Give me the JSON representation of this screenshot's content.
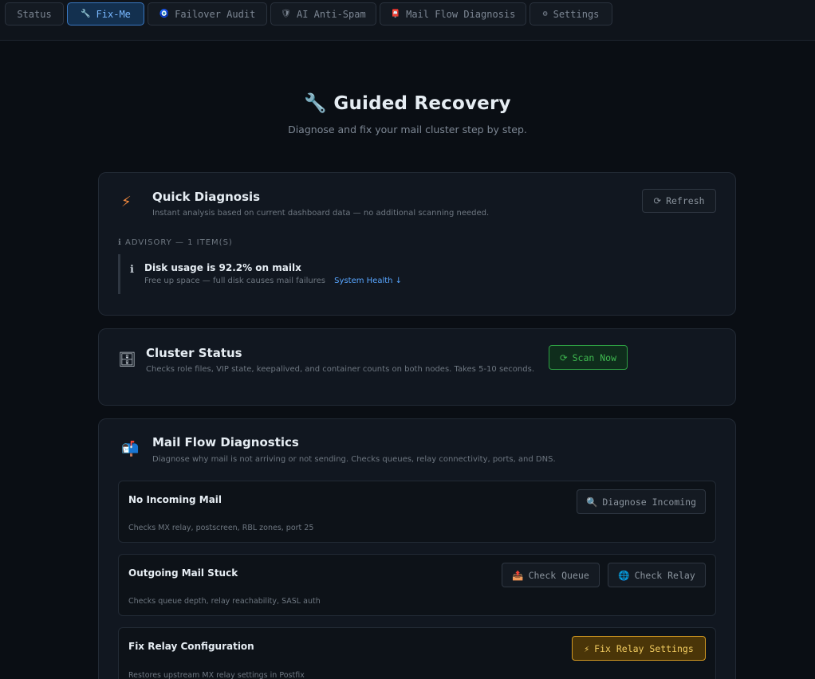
{
  "nav": {
    "tabs": [
      {
        "label": "Status",
        "icon": ""
      },
      {
        "label": "Fix-Me",
        "icon": "🔧"
      },
      {
        "label": "Failover Audit",
        "icon": "🧿"
      },
      {
        "label": "AI Anti-Spam",
        "icon": "🛡"
      },
      {
        "label": "Mail Flow Diagnosis",
        "icon": "📮"
      },
      {
        "label": "Settings",
        "icon": "⚙"
      }
    ],
    "active": "Fix-Me"
  },
  "hero": {
    "icon": "🔧",
    "title": "Guided Recovery",
    "subtitle": "Diagnose and fix your mail cluster step by step."
  },
  "quick": {
    "icon": "⚡",
    "title": "Quick Diagnosis",
    "subtitle": "Instant analysis based on current dashboard data — no additional scanning needed.",
    "refresh_icon": "⟳",
    "refresh_label": "Refresh",
    "advisory_label": "ℹ ADVISORY — 1 ITEM(S)",
    "advisory": {
      "icon": "ℹ",
      "title": "Disk usage is 92.2% on mailx",
      "text": "Free up space — full disk causes mail failures",
      "link": "System Health ↓"
    }
  },
  "cluster": {
    "icon": "🗄",
    "title": "Cluster Status",
    "subtitle": "Checks role files, VIP state, keepalived, and container counts on both nodes. Takes 5-10 seconds.",
    "scan_icon": "⟳",
    "scan_label": "Scan Now"
  },
  "mailflow": {
    "icon": "📬",
    "title": "Mail Flow Diagnostics",
    "subtitle": "Diagnose why mail is not arriving or not sending. Checks queues, relay connectivity, ports, and DNS.",
    "items": [
      {
        "title": "No Incoming Mail",
        "desc": "Checks MX relay, postscreen, RBL zones, port 25",
        "buttons": [
          {
            "icon": "🔍",
            "label": "Diagnose Incoming"
          }
        ]
      },
      {
        "title": "Outgoing Mail Stuck",
        "desc": "Checks queue depth, relay reachability, SASL auth",
        "buttons": [
          {
            "icon": "📤",
            "label": "Check Queue"
          },
          {
            "icon": "🌐",
            "label": "Check Relay"
          }
        ]
      },
      {
        "title": "Fix Relay Configuration",
        "desc": "Restores upstream MX relay settings in Postfix",
        "buttons": [
          {
            "icon": "⚡",
            "label": "Fix Relay Settings"
          }
        ]
      }
    ]
  },
  "colors": {
    "accent": "#58a6ff",
    "success": "#3fb950",
    "warning": "#d29922",
    "background": "#0a0e14"
  }
}
